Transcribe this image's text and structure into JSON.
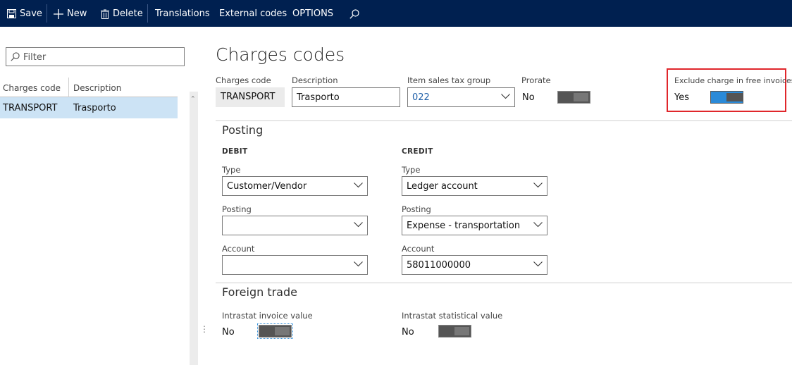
{
  "toolbar": {
    "save": "Save",
    "new": "New",
    "delete": "Delete",
    "translations": "Translations",
    "external_codes": "External codes",
    "options": "OPTIONS"
  },
  "left": {
    "filter_placeholder": "Filter",
    "col_code": "Charges code",
    "col_desc": "Description",
    "rows": [
      {
        "code": "TRANSPORT",
        "desc": "Trasporto"
      }
    ]
  },
  "main": {
    "title": "Charges codes",
    "header": {
      "code_label": "Charges code",
      "code_value": "TRANSPORT",
      "desc_label": "Description",
      "desc_value": "Trasporto",
      "tax_label": "Item sales tax group",
      "tax_value": "022",
      "prorate_label": "Prorate",
      "prorate_value": "No",
      "prorate_on": false,
      "exclude_label": "Exclude charge in free invoices",
      "exclude_value": "Yes",
      "exclude_on": true
    },
    "posting": {
      "title": "Posting",
      "debit": {
        "heading": "DEBIT",
        "type_label": "Type",
        "type_value": "Customer/Vendor",
        "posting_label": "Posting",
        "posting_value": "",
        "account_label": "Account",
        "account_value": ""
      },
      "credit": {
        "heading": "CREDIT",
        "type_label": "Type",
        "type_value": "Ledger account",
        "posting_label": "Posting",
        "posting_value": "Expense - transportation",
        "account_label": "Account",
        "account_value": "58011000000"
      }
    },
    "foreign_trade": {
      "title": "Foreign trade",
      "invoice_label": "Intrastat invoice value",
      "invoice_value": "No",
      "invoice_on": false,
      "statistical_label": "Intrastat statistical value",
      "statistical_value": "No",
      "statistical_on": false
    }
  },
  "colors": {
    "topbar": "#002050",
    "selected_row": "#cce3f5",
    "toggle_on": "#2a8ad8",
    "highlight": "#e0262b",
    "link_value": "#1f5fa8"
  }
}
